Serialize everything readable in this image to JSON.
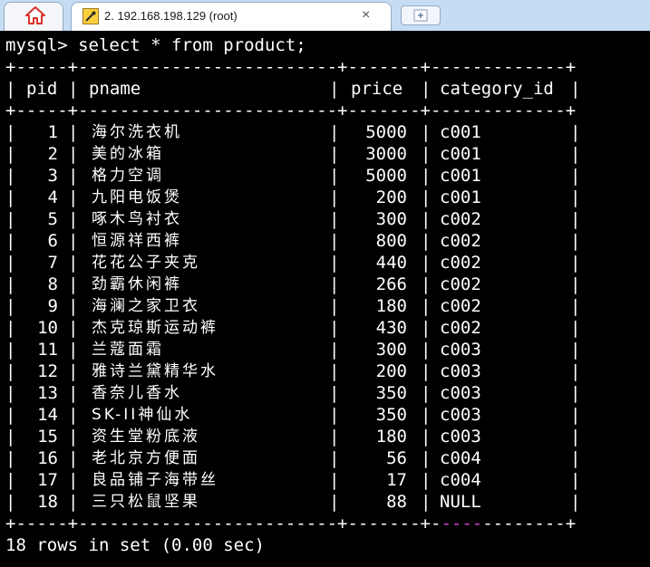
{
  "tabs": {
    "active_title": "2. 192.168.198.129 (root)",
    "close_glyph": "×"
  },
  "terminal": {
    "command_line": "mysql> select * from product;",
    "border_top": "+-----+-------------------------+-------+-------------+",
    "border_mid": "+-----+-------------------------+-------+-------------+",
    "border_bottom_prefix": "+-----+-------------------------+-------+-",
    "border_bottom_magenta": "----",
    "border_bottom_suffix": "--------+",
    "columns": [
      "pid",
      "pname",
      "price",
      "category_id"
    ],
    "rows": [
      {
        "pid": "1",
        "pname": "海尔洗衣机",
        "price": "5000",
        "category_id": "c001"
      },
      {
        "pid": "2",
        "pname": "美的冰箱",
        "price": "3000",
        "category_id": "c001"
      },
      {
        "pid": "3",
        "pname": "格力空调",
        "price": "5000",
        "category_id": "c001"
      },
      {
        "pid": "4",
        "pname": "九阳电饭煲",
        "price": "200",
        "category_id": "c001"
      },
      {
        "pid": "5",
        "pname": "啄木鸟衬衣",
        "price": "300",
        "category_id": "c002"
      },
      {
        "pid": "6",
        "pname": "恒源祥西裤",
        "price": "800",
        "category_id": "c002"
      },
      {
        "pid": "7",
        "pname": "花花公子夹克",
        "price": "440",
        "category_id": "c002"
      },
      {
        "pid": "8",
        "pname": "劲霸休闲裤",
        "price": "266",
        "category_id": "c002"
      },
      {
        "pid": "9",
        "pname": "海澜之家卫衣",
        "price": "180",
        "category_id": "c002"
      },
      {
        "pid": "10",
        "pname": "杰克琼斯运动裤",
        "price": "430",
        "category_id": "c002"
      },
      {
        "pid": "11",
        "pname": "兰蔻面霜",
        "price": "300",
        "category_id": "c003"
      },
      {
        "pid": "12",
        "pname": "雅诗兰黛精华水",
        "price": "200",
        "category_id": "c003"
      },
      {
        "pid": "13",
        "pname": "香奈儿香水",
        "price": "350",
        "category_id": "c003"
      },
      {
        "pid": "14",
        "pname": "SK-II神仙水",
        "price": "350",
        "category_id": "c003"
      },
      {
        "pid": "15",
        "pname": "资生堂粉底液",
        "price": "180",
        "category_id": "c003"
      },
      {
        "pid": "16",
        "pname": "老北京方便面",
        "price": "56",
        "category_id": "c004"
      },
      {
        "pid": "17",
        "pname": "良品铺子海带丝",
        "price": "17",
        "category_id": "c004"
      },
      {
        "pid": "18",
        "pname": "三只松鼠坚果",
        "price": "88",
        "category_id": "NULL"
      }
    ],
    "result_summary": "18 rows in set (0.00 sec)"
  },
  "icons": {
    "home": "home-icon",
    "session": "session-icon",
    "close": "close-icon",
    "new_tab": "new-tab-icon"
  },
  "colors": {
    "tabbar_bg": "#c6dcf2",
    "terminal_bg": "#000000",
    "terminal_fg": "#ffffff",
    "home_icon": "#d9312b",
    "accent_dash": "#d53fd5"
  }
}
